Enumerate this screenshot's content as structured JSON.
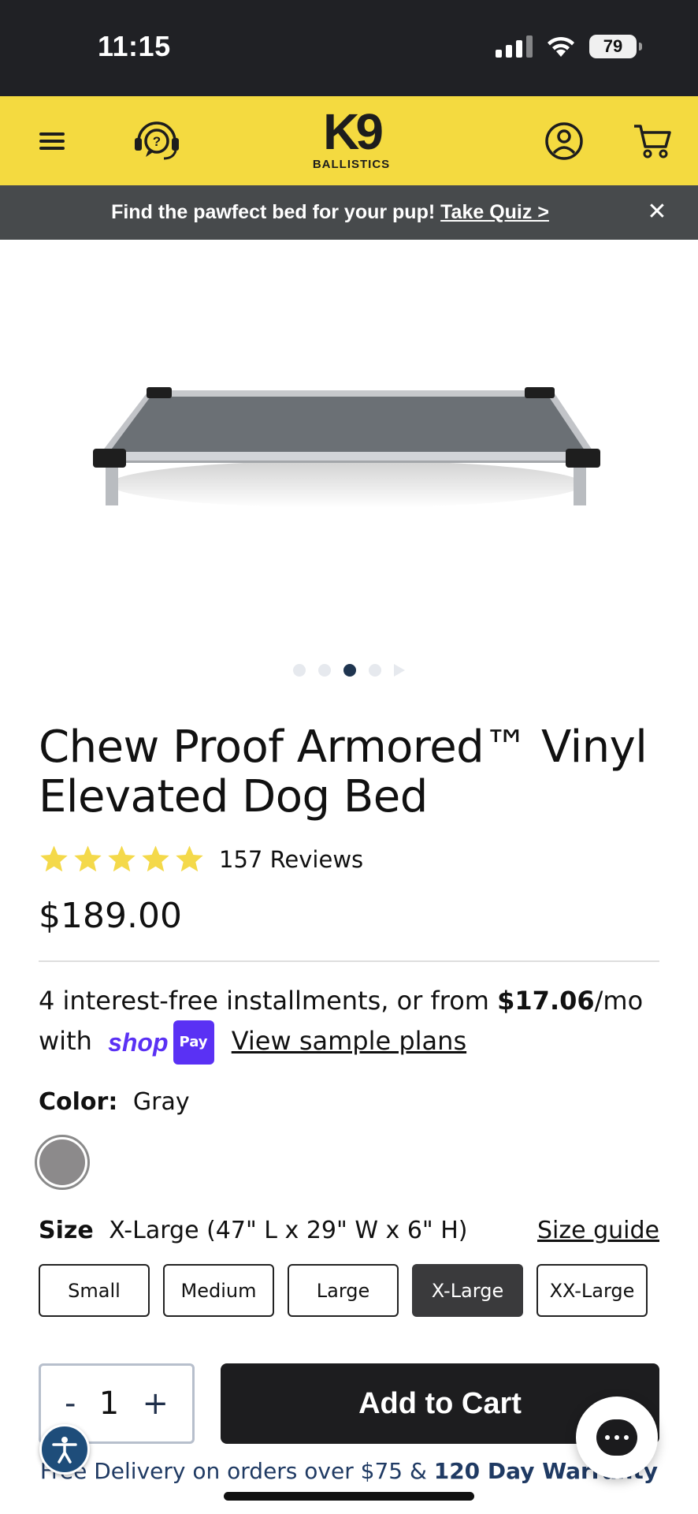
{
  "status_bar": {
    "time": "11:15",
    "battery": "79"
  },
  "header": {
    "logo_main": "K9",
    "logo_sub": "BALLISTICS",
    "icons": [
      "menu-icon",
      "help-headset-icon",
      "account-icon",
      "cart-icon"
    ]
  },
  "promo": {
    "text": "Find the pawfect bed for your pup!",
    "link": "Take Quiz >",
    "close": "✕"
  },
  "gallery": {
    "slide_count": 4,
    "active_slide": 3
  },
  "product": {
    "title": "Chew Proof Armored™ Vinyl Elevated Dog Bed",
    "rating": 5,
    "reviews": "157 Reviews",
    "price": "$189.00",
    "installments": {
      "prefix": "4 interest-free installments, or from",
      "amount": "$17.06",
      "suffix": "/mo",
      "with": "with",
      "shop_word": "shop",
      "pay_badge": "Pay",
      "link": "View sample plans"
    },
    "color": {
      "label": "Color:",
      "value": "Gray",
      "swatch_hex": "#8c8a8b"
    },
    "size": {
      "label": "Size",
      "value": "X-Large (47\" L x 29\" W x 6\" H)",
      "guide": "Size guide",
      "options": [
        "Small",
        "Medium",
        "Large",
        "X-Large",
        "XX-Large"
      ],
      "selected": "X-Large"
    },
    "quantity": {
      "minus": "-",
      "value": "1",
      "plus": "+"
    },
    "add_to_cart": "Add to Cart",
    "delivery": {
      "text": "Free Delivery on orders over $75 &",
      "bold": "120 Day Warranty"
    }
  },
  "colors": {
    "brand_yellow": "#f4da40",
    "dark": "#1d1d1f",
    "shop_purple": "#5a31f4",
    "star_yellow": "#f4d94a",
    "navy": "#1f3a63"
  }
}
